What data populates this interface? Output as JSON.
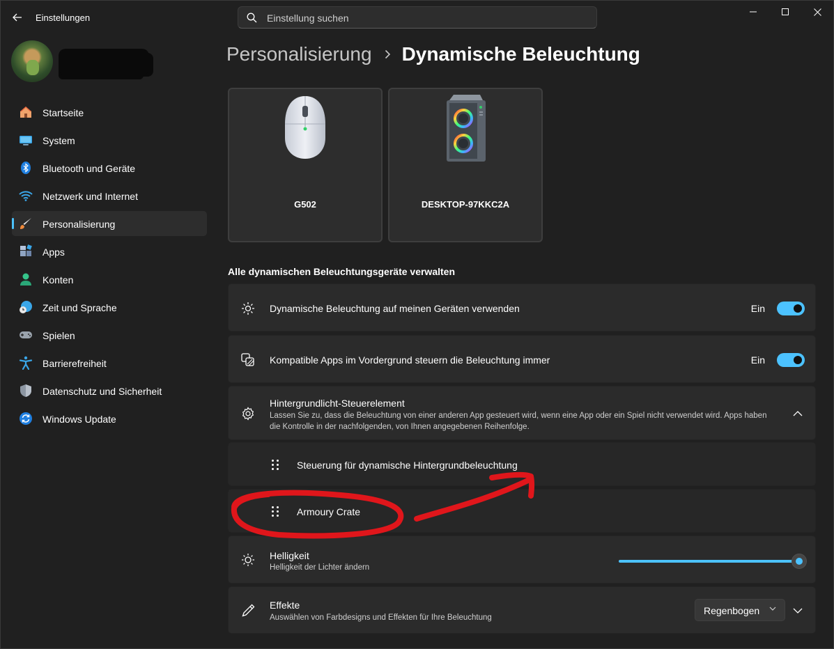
{
  "window": {
    "title": "Einstellungen"
  },
  "search": {
    "placeholder": "Einstellung suchen"
  },
  "sidebar": {
    "items": [
      {
        "label": "Startseite",
        "icon": "home-icon"
      },
      {
        "label": "System",
        "icon": "monitor-icon"
      },
      {
        "label": "Bluetooth und Geräte",
        "icon": "bluetooth-icon"
      },
      {
        "label": "Netzwerk und Internet",
        "icon": "wifi-icon"
      },
      {
        "label": "Personalisierung",
        "icon": "brush-icon",
        "active": true
      },
      {
        "label": "Apps",
        "icon": "apps-icon"
      },
      {
        "label": "Konten",
        "icon": "person-icon"
      },
      {
        "label": "Zeit und Sprache",
        "icon": "globe-clock-icon"
      },
      {
        "label": "Spielen",
        "icon": "gamepad-icon"
      },
      {
        "label": "Barrierefreiheit",
        "icon": "accessibility-icon"
      },
      {
        "label": "Datenschutz und Sicherheit",
        "icon": "shield-icon"
      },
      {
        "label": "Windows Update",
        "icon": "update-icon"
      }
    ]
  },
  "breadcrumb": {
    "parent": "Personalisierung",
    "current": "Dynamische Beleuchtung"
  },
  "devices": [
    {
      "name": "G502",
      "icon": "mouse-icon"
    },
    {
      "name": "DESKTOP-97KKC2A",
      "icon": "pc-tower-icon"
    }
  ],
  "section": {
    "title": "Alle dynamischen Beleuchtungsgeräte verwalten"
  },
  "settings": {
    "use_lighting": {
      "title": "Dynamische Beleuchtung auf meinen Geräten verwenden",
      "state": "Ein",
      "icon": "lighting-icon"
    },
    "foreground_apps": {
      "title": "Kompatible Apps im Vordergrund steuern die Beleuchtung immer",
      "state": "Ein",
      "icon": "apps-control-icon"
    },
    "background_control": {
      "title": "Hintergrundlicht-Steuerelement",
      "description": "Lassen Sie zu, dass die Beleuchtung von einer anderen App gesteuert wird, wenn eine App oder ein Spiel nicht verwendet wird. Apps haben die Kontrolle in der nachfolgenden, von Ihnen angegebenen Reihenfolge.",
      "icon": "gear-icon",
      "items": [
        {
          "label": "Steuerung für dynamische Hintergrundbeleuchtung"
        },
        {
          "label": "Armoury Crate"
        }
      ]
    },
    "brightness": {
      "title": "Helligkeit",
      "description": "Helligkeit der Lichter ändern",
      "value_percent": 100,
      "icon": "sun-icon"
    },
    "effects": {
      "title": "Effekte",
      "description": "Auswählen von Farbdesigns und Effekten für Ihre Beleuchtung",
      "selected": "Regenbogen",
      "icon": "pen-icon"
    }
  },
  "colors": {
    "accent": "#4cc2ff",
    "annotation": "#e0161b",
    "background": "#202020",
    "card": "#2b2b2b"
  }
}
